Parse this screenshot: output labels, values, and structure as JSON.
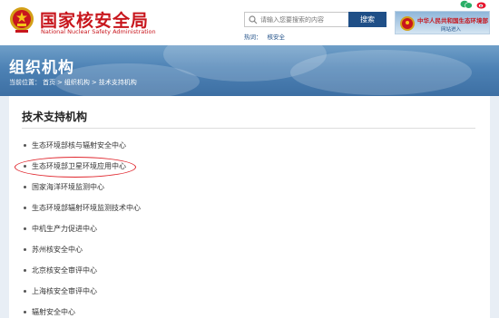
{
  "header": {
    "site_title": "国家核安全局",
    "site_subtitle": "National Nuclear Safety Administration",
    "search_placeholder": "请输入您要搜索的内容",
    "search_button": "搜索",
    "hot_label": "热词：",
    "hot_keyword": "核安全",
    "ministry_title": "中华人民共和国生态环境部",
    "ministry_link": "网站进入",
    "colors": {
      "brand_red": "#c8161d",
      "navy": "#1f4f87"
    }
  },
  "banner": {
    "title": "组织机构",
    "breadcrumb_prefix": "当前位置：",
    "breadcrumb": [
      "首页",
      ">",
      "组织机构",
      ">",
      "技术支持机构"
    ]
  },
  "content": {
    "title": "技术支持机构",
    "items": [
      "生态环境部核与辐射安全中心",
      "生态环境部卫星环境应用中心",
      "国家海洋环境监测中心",
      "生态环境部辐射环境监测技术中心",
      "中机生产力促进中心",
      "苏州核安全中心",
      "北京核安全审评中心",
      "上海核安全审评中心",
      "辐射安全中心"
    ],
    "highlighted_index": 1
  }
}
